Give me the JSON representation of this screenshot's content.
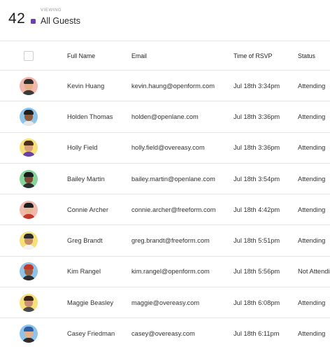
{
  "header": {
    "count": "42",
    "viewing_label": "VIEWING",
    "view_name": "All Guests",
    "view_color": "#6b3fb5"
  },
  "table": {
    "columns": {
      "name": "Full Name",
      "email": "Email",
      "time": "Time of RSVP",
      "status": "Status"
    },
    "rows": [
      {
        "name": "Kevin Huang",
        "email": "kevin.haung@openform.com",
        "time": "Jul 18th 3:34pm",
        "status": "Attending",
        "avatar_bg": "#f2b8ae",
        "skin": "#e3b08a",
        "hair": "#2e2e2e",
        "shirt": "#3b3b3b"
      },
      {
        "name": "Holden Thomas",
        "email": "holden@openlane.com",
        "time": "Jul 18th 3:36pm",
        "status": "Attending",
        "avatar_bg": "#8ec4ea",
        "skin": "#8a5a3b",
        "hair": "#1f1f1f",
        "shirt": "#e9e9e9"
      },
      {
        "name": "Holly Field",
        "email": "holly.field@overeasy.com",
        "time": "Jul 18th 3:36pm",
        "status": "Attending",
        "avatar_bg": "#f5e07a",
        "skin": "#d9a27a",
        "hair": "#4a2e1e",
        "shirt": "#6a3fa6"
      },
      {
        "name": "Bailey Martin",
        "email": "bailey.martin@openlane.com",
        "time": "Jul 18th 3:54pm",
        "status": "Attending",
        "avatar_bg": "#84d49b",
        "skin": "#7a4b30",
        "hair": "#1c1c1c",
        "shirt": "#2d2d2d"
      },
      {
        "name": "Connie Archer",
        "email": "connie.archer@freeform.com",
        "time": "Jul 18th 4:42pm",
        "status": "Attending",
        "avatar_bg": "#f2b8ae",
        "skin": "#e6b996",
        "hair": "#1e1e1e",
        "shirt": "#c0392b"
      },
      {
        "name": "Greg Brandt",
        "email": "greg.brandt@freeform.com",
        "time": "Jul 18th 5:51pm",
        "status": "Attending",
        "avatar_bg": "#f5e07a",
        "skin": "#c68e63",
        "hair": "#2b2b2b",
        "shirt": "#f3f3f3"
      },
      {
        "name": "Kim Rangel",
        "email": "kim.rangel@openform.com",
        "time": "Jul 18th 5:56pm",
        "status": "Not Attending",
        "avatar_bg": "#8ec4ea",
        "skin": "#9a6244",
        "hair": "#c0392b",
        "shirt": "#2d2d2d"
      },
      {
        "name": "Maggie Beasley",
        "email": "maggie@overeasy.com",
        "time": "Jul 18th 6:08pm",
        "status": "Attending",
        "avatar_bg": "#f5e07a",
        "skin": "#c89070",
        "hair": "#3a2418",
        "shirt": "#4a4a4a"
      },
      {
        "name": "Casey Friedman",
        "email": "casey@overeasy.com",
        "time": "Jul 18th 6:11pm",
        "status": "Attending",
        "avatar_bg": "#8ec4ea",
        "skin": "#e3b08a",
        "hair": "#2c5fa8",
        "shirt": "#2d2d2d"
      }
    ]
  }
}
